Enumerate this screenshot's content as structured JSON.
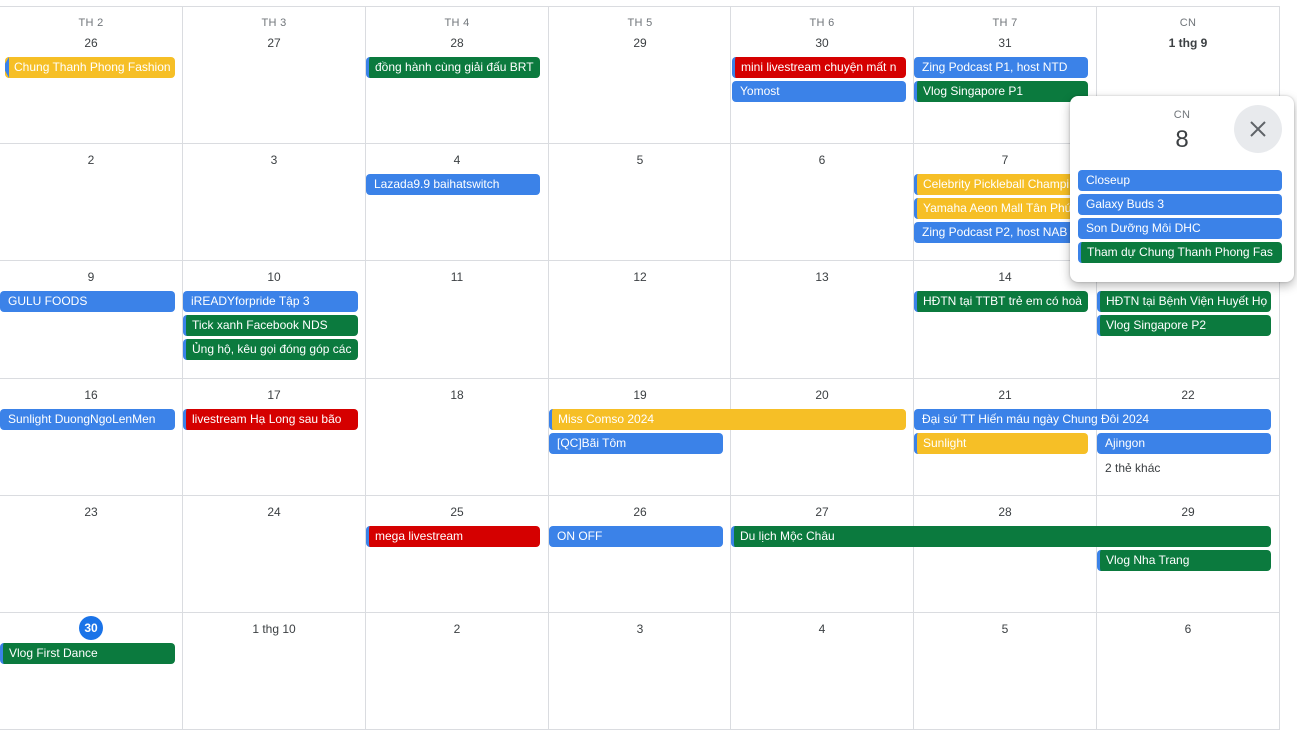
{
  "weekdays": [
    "TH 2",
    "TH 3",
    "TH 4",
    "TH 5",
    "TH 6",
    "TH 7",
    "CN"
  ],
  "weeks": [
    [
      "26",
      "27",
      "28",
      "29",
      "30",
      "31",
      "1 thg 9"
    ],
    [
      "2",
      "3",
      "4",
      "5",
      "6",
      "7",
      ""
    ],
    [
      "9",
      "10",
      "11",
      "12",
      "13",
      "14",
      ""
    ],
    [
      "16",
      "17",
      "18",
      "19",
      "20",
      "21",
      "22"
    ],
    [
      "23",
      "24",
      "25",
      "26",
      "27",
      "28",
      "29"
    ],
    [
      "30",
      "1 thg 10",
      "2",
      "3",
      "4",
      "5",
      "6"
    ]
  ],
  "events": [
    {
      "label": "Chung Thanh Phong Fashion",
      "color": "yellow"
    },
    {
      "label": "đồng hành cùng giải đấu BRT",
      "color": "green"
    },
    {
      "label": "mini livestream chuyện mất n",
      "color": "red"
    },
    {
      "label": "Yomost",
      "color": "blue"
    },
    {
      "label": "Zing Podcast P1, host NTD",
      "color": "blue"
    },
    {
      "label": "Vlog Singapore P1",
      "color": "green"
    },
    {
      "label": "Lazada9.9 baihatswitch",
      "color": "blue"
    },
    {
      "label": "Celebrity Pickleball Champi",
      "color": "yellow"
    },
    {
      "label": "Yamaha Aeon Mall Tân Phú",
      "color": "yellow"
    },
    {
      "label": "Zing Podcast P2, host NAB",
      "color": "blue"
    },
    {
      "label": "GULU FOODS",
      "color": "blue"
    },
    {
      "label": "iREADYforpride Tập 3",
      "color": "blue"
    },
    {
      "label": "Tick xanh Facebook NDS",
      "color": "green"
    },
    {
      "label": "Ủng hộ, kêu gọi đóng góp các",
      "color": "green"
    },
    {
      "label": "HĐTN tại TTBT trẻ em có hoà",
      "color": "green"
    },
    {
      "label": "HĐTN tại Bệnh Viện Huyết Họ",
      "color": "green"
    },
    {
      "label": "Vlog Singapore P2",
      "color": "green"
    },
    {
      "label": "Sunlight DuongNgoLenMen",
      "color": "blue"
    },
    {
      "label": "livestream Hạ Long sau bão",
      "color": "red"
    },
    {
      "label": "Miss Comso 2024",
      "color": "yellow"
    },
    {
      "label": "[QC]Bãi Tôm",
      "color": "blue"
    },
    {
      "label": "Đại sứ TT Hiến máu ngày Chung Đôi 2024",
      "color": "blue"
    },
    {
      "label": "Sunlight",
      "color": "yellow"
    },
    {
      "label": "Ajingon",
      "color": "blue"
    },
    {
      "label": "mega livestream",
      "color": "red"
    },
    {
      "label": "ON OFF",
      "color": "blue"
    },
    {
      "label": "Du lịch Mộc Châu",
      "color": "green"
    },
    {
      "label": "Vlog Nha Trang",
      "color": "green"
    },
    {
      "label": "Vlog First Dance",
      "color": "green"
    }
  ],
  "more_link": "2 thẻ khác",
  "popup": {
    "weekday": "CN",
    "day": "8",
    "events": [
      {
        "label": "Closeup",
        "color": "blue"
      },
      {
        "label": "Galaxy Buds 3",
        "color": "blue"
      },
      {
        "label": "Son Dưỡng Môi DHC",
        "color": "blue"
      },
      {
        "label": "Tham dự Chung Thanh Phong Fas",
        "color": "green"
      }
    ]
  },
  "colors": {
    "blue": "#3b82e8",
    "green": "#0b7a3e",
    "red": "#d50000",
    "yellow": "#f6bf26",
    "today": "#1a73e8"
  }
}
